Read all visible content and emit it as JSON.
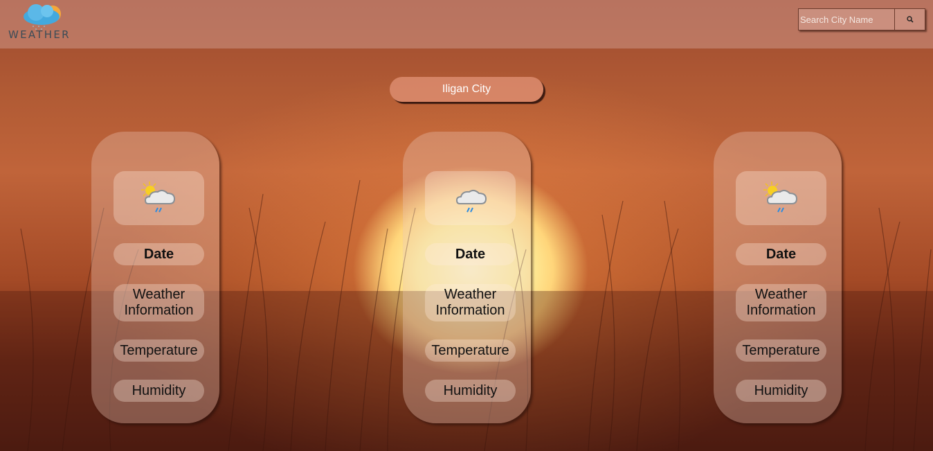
{
  "header": {
    "logo_text": "WEATHER",
    "search_placeholder": "Search City Name",
    "search_button_icon": "search-icon"
  },
  "city": {
    "name": "Iligan City"
  },
  "forecast_cards": [
    {
      "icon": "sun-cloud-rain-icon",
      "date": "Date",
      "weather_info": "Weather Information",
      "temperature": "Temperature",
      "humidity": "Humidity"
    },
    {
      "icon": "cloud-rain-icon",
      "date": "Date",
      "weather_info": "Weather Information",
      "temperature": "Temperature",
      "humidity": "Humidity"
    },
    {
      "icon": "sun-cloud-rain-icon",
      "date": "Date",
      "weather_info": "Weather Information",
      "temperature": "Temperature",
      "humidity": "Humidity"
    }
  ],
  "colors": {
    "sunset_sky": "#c0643a",
    "sun_core": "#fff2a0",
    "card_fill": "#ebc8b9",
    "text": "#111111"
  }
}
